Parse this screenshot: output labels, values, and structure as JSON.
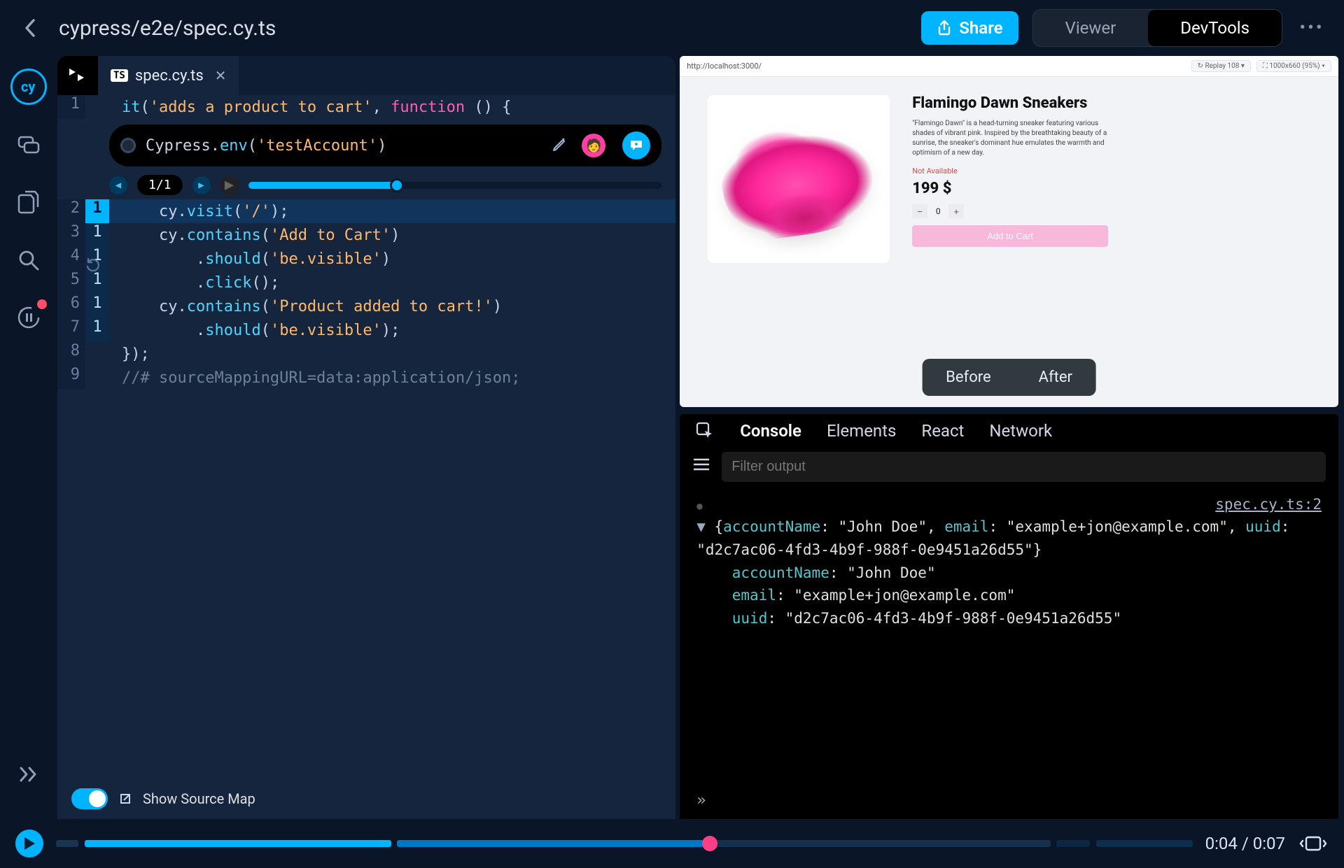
{
  "header": {
    "breadcrumb": "cypress/e2e/spec.cy.ts",
    "share_label": "Share",
    "tabs": {
      "viewer": "Viewer",
      "devtools": "DevTools"
    }
  },
  "editor": {
    "filename": "spec.cy.ts",
    "expression_bar": {
      "obj": "Cypress",
      "method": "env",
      "arg": "'testAccount'"
    },
    "step_counter": "1/1",
    "lines": [
      {
        "n1": "1",
        "n2": "",
        "hl": false,
        "indent": 0,
        "tokens": [
          [
            "fn",
            "it"
          ],
          [
            "id",
            "("
          ],
          [
            "str",
            "'adds a product to cart'"
          ],
          [
            "id",
            ", "
          ],
          [
            "kw",
            "function "
          ],
          [
            "id",
            "() {"
          ]
        ]
      },
      {
        "n1": "2",
        "n2": "1",
        "hl": true,
        "indent": 2,
        "tokens": [
          [
            "id",
            "cy."
          ],
          [
            "fn",
            "visit"
          ],
          [
            "id",
            "("
          ],
          [
            "str",
            "'/'"
          ],
          [
            "id",
            ");"
          ]
        ]
      },
      {
        "n1": "3",
        "n2": "1",
        "hl": false,
        "indent": 2,
        "tokens": [
          [
            "id",
            "cy."
          ],
          [
            "fn",
            "contains"
          ],
          [
            "id",
            "("
          ],
          [
            "str",
            "'Add to Cart'"
          ],
          [
            "id",
            ")"
          ]
        ]
      },
      {
        "n1": "4",
        "n2": "1",
        "hl": false,
        "indent": 4,
        "tokens": [
          [
            "id",
            "."
          ],
          [
            "fn",
            "should"
          ],
          [
            "id",
            "("
          ],
          [
            "str",
            "'be.visible'"
          ],
          [
            "id",
            ")"
          ]
        ]
      },
      {
        "n1": "5",
        "n2": "1",
        "hl": false,
        "indent": 4,
        "tokens": [
          [
            "id",
            "."
          ],
          [
            "fn",
            "click"
          ],
          [
            "id",
            "();"
          ]
        ]
      },
      {
        "n1": "6",
        "n2": "1",
        "hl": false,
        "indent": 2,
        "tokens": [
          [
            "id",
            "cy."
          ],
          [
            "fn",
            "contains"
          ],
          [
            "id",
            "("
          ],
          [
            "str",
            "'Product added to cart!'"
          ],
          [
            "id",
            ")"
          ]
        ]
      },
      {
        "n1": "7",
        "n2": "1",
        "hl": false,
        "indent": 4,
        "tokens": [
          [
            "id",
            "."
          ],
          [
            "fn",
            "should"
          ],
          [
            "id",
            "("
          ],
          [
            "str",
            "'be.visible'"
          ],
          [
            "id",
            ");"
          ]
        ]
      },
      {
        "n1": "8",
        "n2": "",
        "hl": false,
        "indent": 0,
        "tokens": [
          [
            "id",
            "});"
          ]
        ]
      },
      {
        "n1": "9",
        "n2": "",
        "hl": false,
        "indent": 0,
        "tokens": [
          [
            "cmt",
            "//# sourceMappingURL=data:application/json;"
          ]
        ]
      }
    ],
    "source_map_label": "Show Source Map"
  },
  "viewer": {
    "url": "http://localhost:3000/",
    "replay_pill": "↻ Replay 108 ▾",
    "size_pill": "⛶ 1000x660 (95%) ▾",
    "product": {
      "title": "Flamingo Dawn Sneakers",
      "description": "\"Flamingo Dawn\" is a head-turning sneaker featuring various shades of vibrant pink. Inspired by the breathtaking beauty of a sunrise, the sneaker's dominant hue emulates the warmth and optimism of a new day.",
      "availability": "Not Available",
      "price": "199 $",
      "qty": "0",
      "add_to_cart": "Add to Cart"
    },
    "before_after": {
      "before": "Before",
      "after": "After"
    }
  },
  "devtools": {
    "tabs": {
      "console": "Console",
      "elements": "Elements",
      "react": "React",
      "network": "Network"
    },
    "filter_placeholder": "Filter output",
    "source_ref": "spec.cy.ts:2",
    "object": {
      "summary_prefix": "{",
      "summary_suffix": "}",
      "accountName": "John Doe",
      "email": "example+jon@example.com",
      "uuid": "d2c7ac06-4fd3-4b9f-988f-0e9451a26d55"
    }
  },
  "playback": {
    "current": "0:04",
    "total": "0:07"
  }
}
